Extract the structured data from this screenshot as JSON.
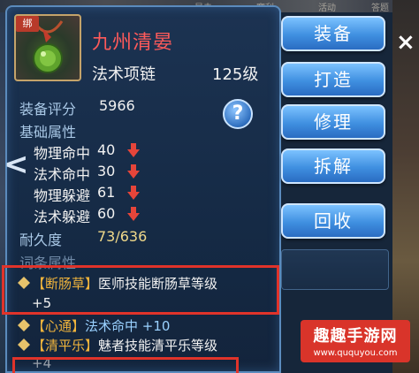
{
  "item": {
    "bind_badge": "绑",
    "name": "九州清晏",
    "type": "法术项链",
    "level": "125级"
  },
  "score": {
    "label": "装备评分",
    "value": "5966"
  },
  "base_attrs": {
    "heading": "基础属性",
    "rows": [
      {
        "name": "物理命中",
        "value": "40"
      },
      {
        "name": "法术命中",
        "value": "30"
      },
      {
        "name": "物理躲避",
        "value": "61"
      },
      {
        "name": "法术躲避",
        "value": "60"
      }
    ]
  },
  "durability": {
    "label": "耐久度",
    "value": "73/636"
  },
  "entries": {
    "heading": "词条属性",
    "lines": [
      {
        "tag": "【断肠草】",
        "text": "医师技能断肠草等级",
        "cont": "+5"
      },
      {
        "tag": "【心通】",
        "text": "法术命中 +10"
      },
      {
        "tag": "【清平乐】",
        "text": "魅者技能清平乐等级",
        "cont": "+4"
      }
    ]
  },
  "buttons": {
    "equip": "装备",
    "forge": "打造",
    "repair": "修理",
    "dismantle": "拆解",
    "recycle": "回收"
  },
  "help_label": "?",
  "close_label": "×",
  "nav_prev": "<",
  "watermark": {
    "title": "趣趣手游网",
    "url": "www.ququyou.com"
  },
  "colors": {
    "item_name": "#ff5a5a",
    "attr_tag": "#f0b43c",
    "durability": "#f0d98a",
    "highlight": "#e0332a",
    "button": "#3f8fe0"
  },
  "background_text": [
    "暴击",
    "寒利",
    "活动",
    "答题"
  ]
}
